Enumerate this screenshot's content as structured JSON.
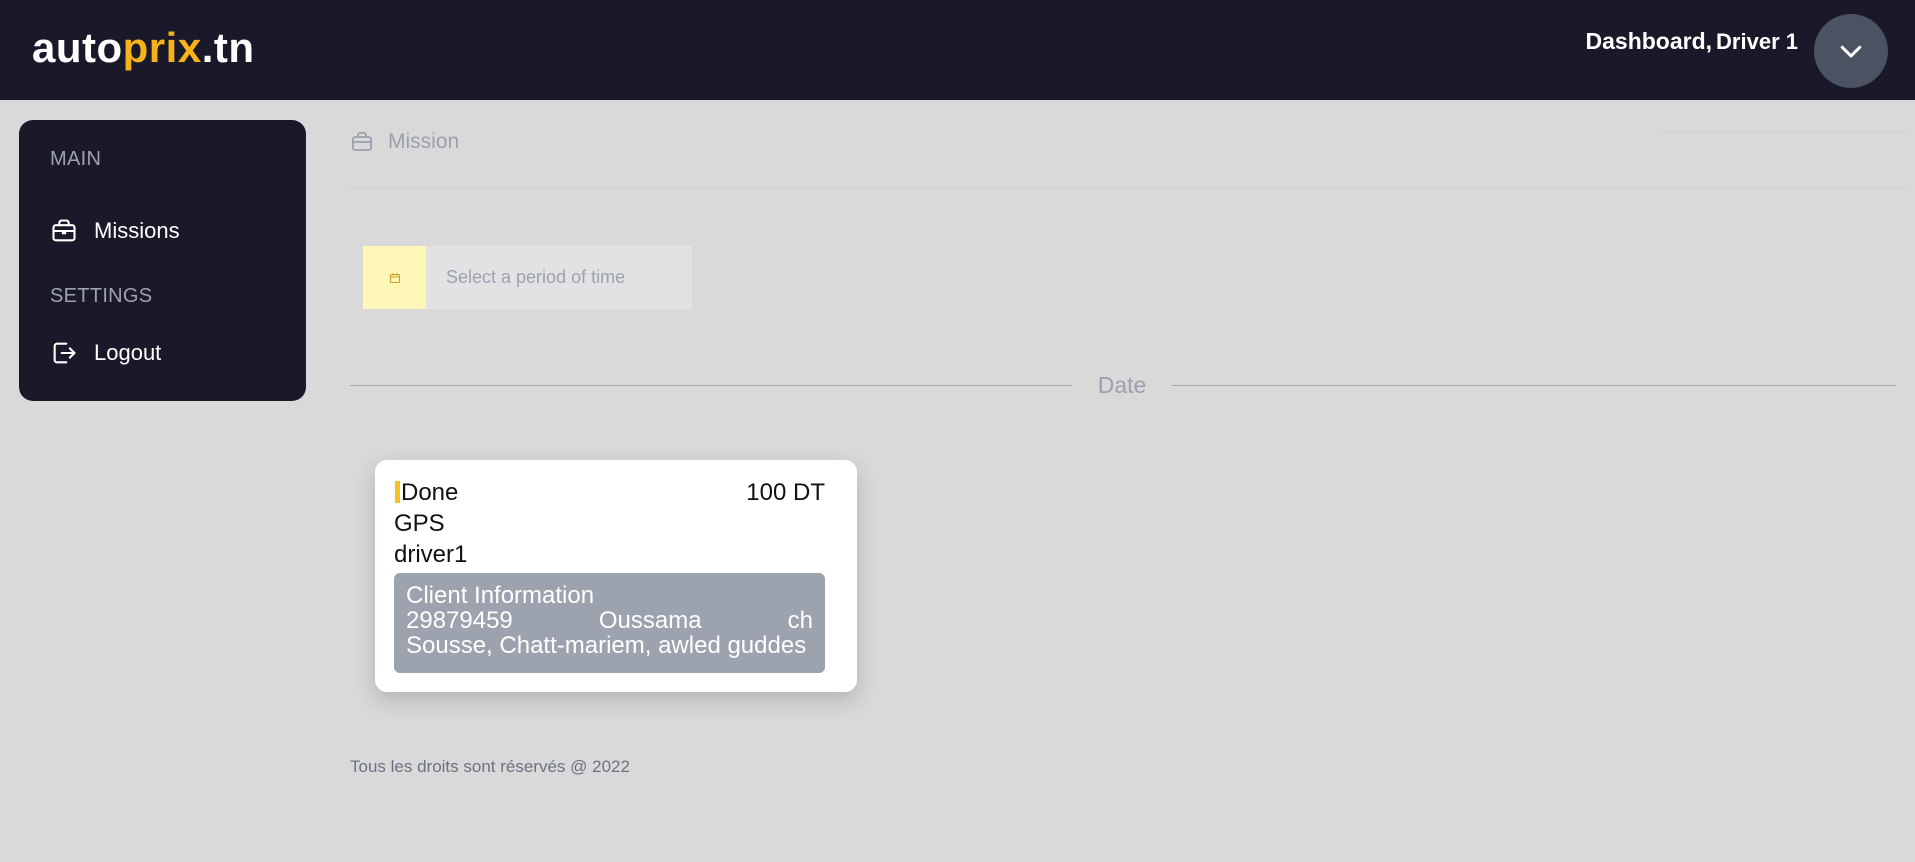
{
  "header": {
    "logo_part1": "auto",
    "logo_part2": "prix",
    "logo_part3": ".tn",
    "greeting": "Dashboard,",
    "user_name": "Driver 1"
  },
  "sidebar": {
    "section_main": "MAIN",
    "missions_label": "Missions",
    "section_settings": "SETTINGS",
    "logout_label": "Logout"
  },
  "breadcrumb": {
    "title": "Mission"
  },
  "filter": {
    "placeholder": "Select a period of time"
  },
  "divider": {
    "label": "Date"
  },
  "mission_card": {
    "status": "Done",
    "price": "100 DT",
    "service": "GPS",
    "driver": "driver1",
    "client_title": "Client Information",
    "client_phone": "29879459",
    "client_first_name": "Oussama",
    "client_last_name": "ch",
    "client_address": "Sousse, Chatt-mariem, awled guddes",
    "status_color": "#f6c21b"
  },
  "footer": {
    "text": "Tous les droits sont réservés @ 2022"
  },
  "colors": {
    "nav_bg": "#1a1829",
    "accent": "#f6b21b",
    "page_bg": "#dad9da"
  }
}
